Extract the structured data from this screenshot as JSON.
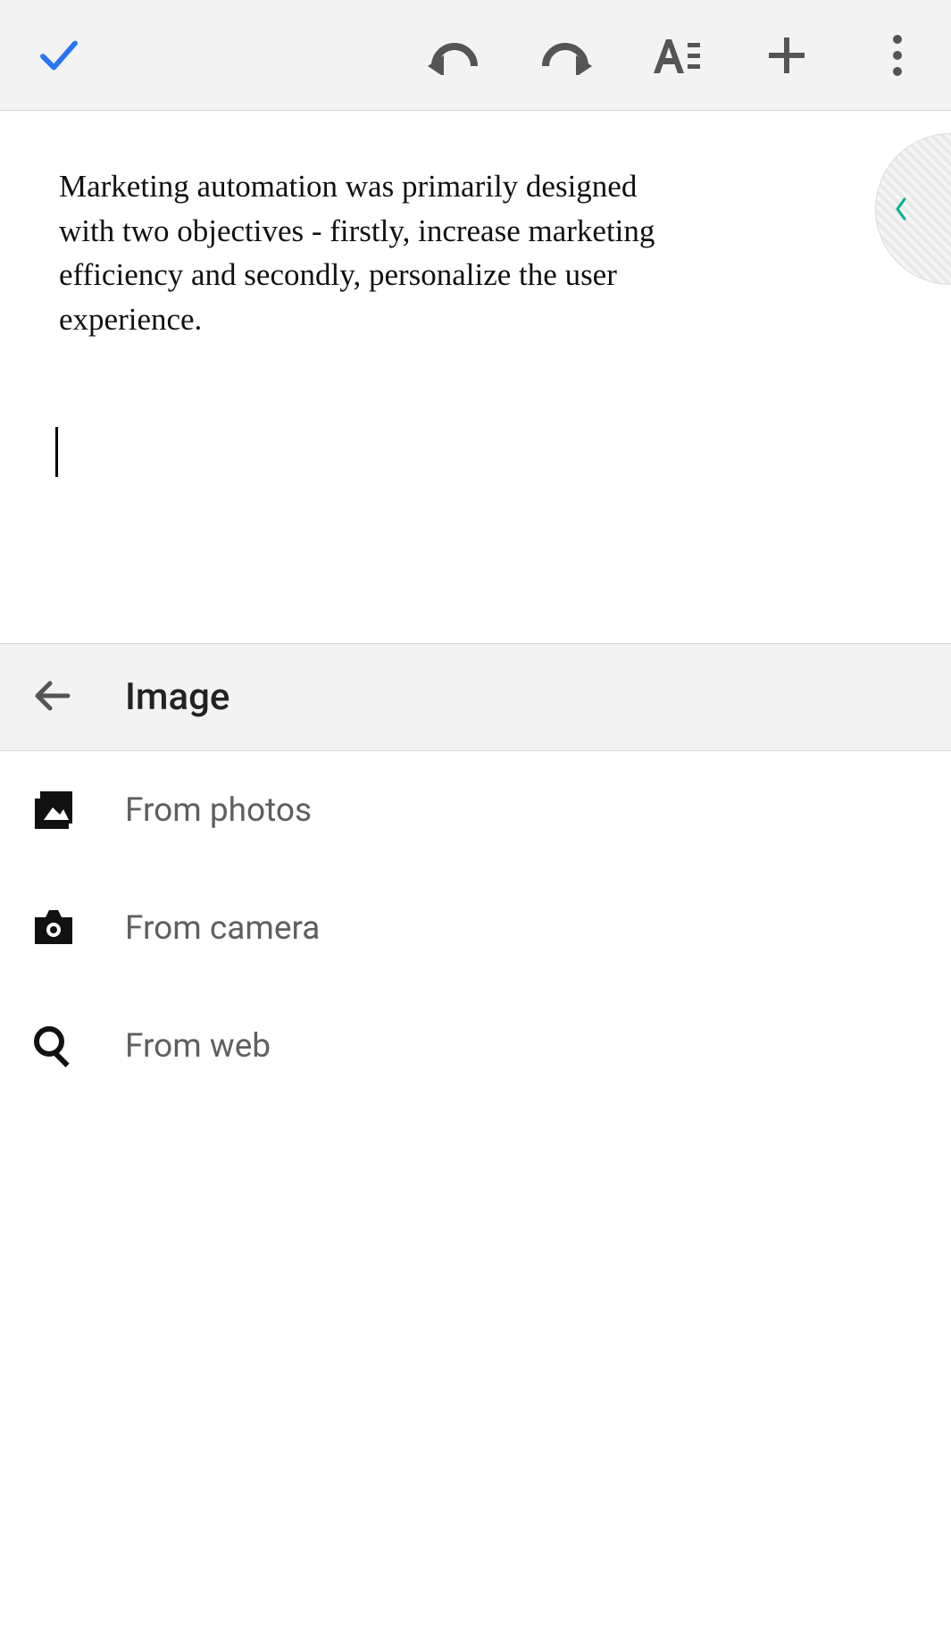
{
  "document": {
    "body_text": "Marketing automation was primarily designed with two objectives - firstly, increase marketing efficiency and secondly, personalize the user experience."
  },
  "sheet": {
    "title": "Image",
    "items": [
      {
        "label": "From photos"
      },
      {
        "label": "From camera"
      },
      {
        "label": "From web"
      }
    ]
  }
}
